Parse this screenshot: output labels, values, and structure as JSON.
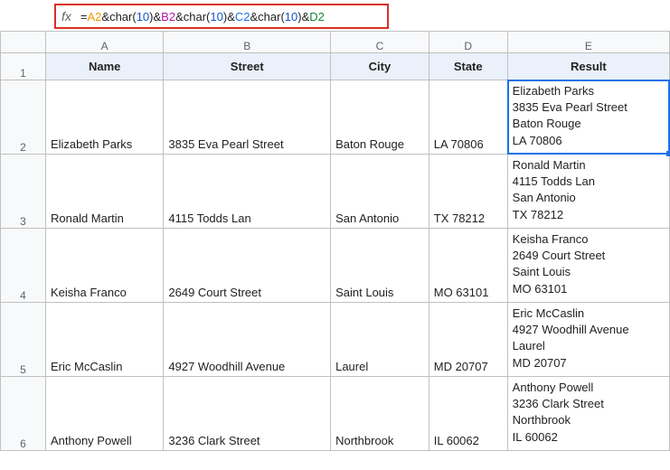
{
  "formula_bar": {
    "label": "fx",
    "eq": "=",
    "a2": "A2",
    "amp": "&",
    "char_open": "char(",
    "ten": "10",
    "char_close": ")",
    "b2": "B2",
    "c2": "C2",
    "d2": "D2"
  },
  "columns": {
    "a": "A",
    "b": "B",
    "c": "C",
    "d": "D",
    "e": "E"
  },
  "rownums": {
    "r1": "1",
    "r2": "2",
    "r3": "3",
    "r4": "4",
    "r5": "5",
    "r6": "6"
  },
  "headers": {
    "name": "Name",
    "street": "Street",
    "city": "City",
    "state": "State",
    "result": "Result"
  },
  "rows": [
    {
      "name": "Elizabeth Parks",
      "street": "3835 Eva Pearl Street",
      "city": "Baton Rouge",
      "state": "LA 70806",
      "result": "Elizabeth Parks\n3835 Eva Pearl Street\nBaton Rouge\nLA 70806"
    },
    {
      "name": "Ronald Martin",
      "street": "4115 Todds Lan",
      "city": "San Antonio",
      "state": "TX 78212",
      "result": "Ronald Martin\n4115 Todds Lan\nSan Antonio\nTX 78212"
    },
    {
      "name": "Keisha Franco",
      "street": "2649 Court Street",
      "city": "Saint Louis",
      "state": "MO 63101",
      "result": "Keisha Franco\n2649 Court Street\nSaint Louis\nMO 63101"
    },
    {
      "name": "Eric McCaslin",
      "street": "4927 Woodhill Avenue",
      "city": "Laurel",
      "state": "MD 20707",
      "result": "Eric McCaslin\n4927 Woodhill Avenue\nLaurel\nMD 20707"
    },
    {
      "name": "Anthony Powell",
      "street": "3236 Clark Street",
      "city": "Northbrook",
      "state": "IL 60062",
      "result": "Anthony Powell\n3236 Clark Street\nNorthbrook\nIL 60062"
    }
  ]
}
